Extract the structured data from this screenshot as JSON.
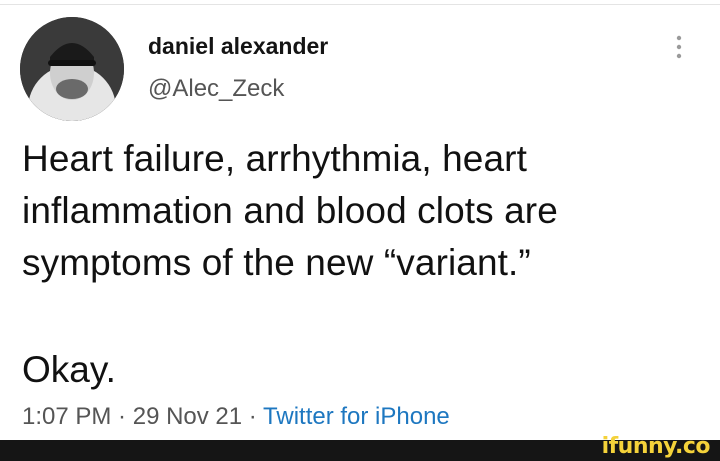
{
  "author": {
    "display_name": "daniel alexander",
    "handle": "@Alec_Zeck"
  },
  "tweet": {
    "lines": [
      "Heart failure, arrhythmia, heart",
      "inflammation and blood clots are",
      "symptoms of the new “variant.”"
    ],
    "second_paragraph": "Okay."
  },
  "meta": {
    "time": "1:07 PM",
    "separator1": " · ",
    "date": "29 Nov 21",
    "separator2": " · ",
    "source": "Twitter for iPhone"
  },
  "footer": {
    "brand": "ifunny.co",
    "brand_color": "#f4d23a"
  },
  "icons": {
    "more": "more-vertical-icon",
    "avatar": "avatar"
  }
}
